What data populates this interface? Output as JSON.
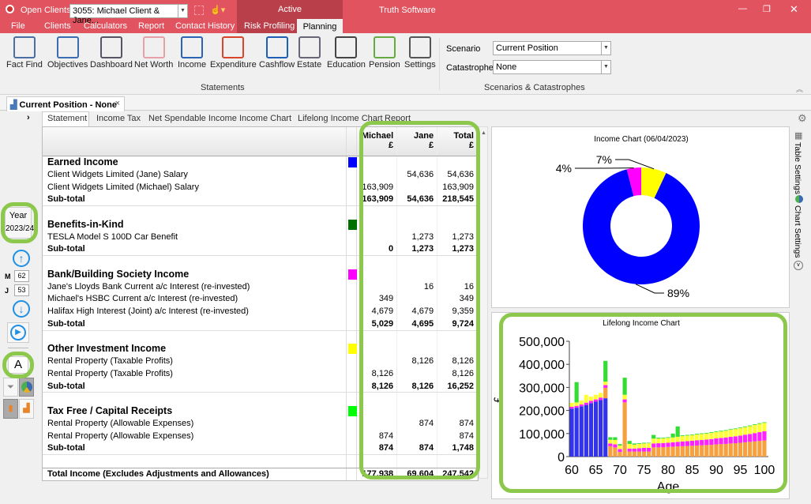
{
  "titlebar": {
    "open_clients_label": "Open Clients:",
    "client": "3055: Michael Client & Jane...",
    "active": "Active",
    "app": "Truth Software"
  },
  "menu": [
    "File",
    "Clients",
    "Calculators",
    "Report",
    "Contact History",
    "Risk Profiling",
    "Planning"
  ],
  "ribbon": {
    "buttons": [
      {
        "label": "Fact Find",
        "icon": "fact-find-icon"
      },
      {
        "label": "Objectives",
        "icon": "mountain-flag-icon"
      },
      {
        "label": "Dashboard",
        "icon": "gauge-icon"
      },
      {
        "label": "Net Worth",
        "icon": "piggy-bank-icon"
      },
      {
        "label": "Income",
        "icon": "rising-chart-icon"
      },
      {
        "label": "Expenditure",
        "icon": "falling-chart-icon"
      },
      {
        "label": "Cashflow",
        "icon": "cashflow-icon"
      },
      {
        "label": "Estate",
        "icon": "document-quill-icon"
      },
      {
        "label": "Education",
        "icon": "graduation-cap-icon"
      },
      {
        "label": "Pension",
        "icon": "coins-plant-icon"
      },
      {
        "label": "Settings",
        "icon": "sliders-icon"
      }
    ],
    "group_label": "Statements",
    "scenario_label": "Scenario",
    "scenario_value": "Current Position",
    "catastrophe_label": "Catastrophe",
    "catastrophe_value": "None",
    "group2_label": "Scenarios & Catastrophes"
  },
  "doc_tab": "Current Position - None",
  "sub_tabs": [
    "Statement",
    "Income Tax",
    "Net Spendable Income",
    "Income Chart",
    "Lifelong Income Chart",
    "Report"
  ],
  "left": {
    "year_label": "Year",
    "year_value": "2023/24",
    "m_label": "M",
    "m_value": "62",
    "j_label": "J",
    "j_value": "53",
    "a_label": "A"
  },
  "table": {
    "headers": [
      {
        "name": "Michael",
        "unit": "£"
      },
      {
        "name": "Jane",
        "unit": "£"
      },
      {
        "name": "Total",
        "unit": "£"
      }
    ],
    "rows": [
      {
        "t": "sec",
        "label": "Earned Income",
        "color": "#0000ff"
      },
      {
        "label": "Client Widgets Limited (Jane) Salary",
        "v": [
          "",
          "54,636",
          "54,636"
        ]
      },
      {
        "label": "Client Widgets Limited (Michael) Salary",
        "v": [
          "163,909",
          "",
          "163,909"
        ]
      },
      {
        "t": "sub",
        "label": "Sub-total",
        "v": [
          "163,909",
          "54,636",
          "218,545"
        ]
      },
      {
        "t": "blank"
      },
      {
        "t": "sec",
        "label": "Benefits-in-Kind",
        "color": "#007000"
      },
      {
        "label": "TESLA Model S 100D Car Benefit",
        "v": [
          "",
          "1,273",
          "1,273"
        ]
      },
      {
        "t": "sub",
        "label": "Sub-total",
        "v": [
          "0",
          "1,273",
          "1,273"
        ]
      },
      {
        "t": "blank"
      },
      {
        "t": "sec",
        "label": "Bank/Building Society Income",
        "color": "#ff00ff"
      },
      {
        "label": "Jane's Lloyds Bank Current a/c Interest (re-invested)",
        "v": [
          "",
          "16",
          "16"
        ]
      },
      {
        "label": "Michael's HSBC Current a/c Interest (re-invested)",
        "v": [
          "349",
          "",
          "349"
        ]
      },
      {
        "label": "Halifax High Interest (Joint) a/c Interest (re-invested)",
        "v": [
          "4,679",
          "4,679",
          "9,359"
        ]
      },
      {
        "t": "sub",
        "label": "Sub-total",
        "v": [
          "5,029",
          "4,695",
          "9,724"
        ]
      },
      {
        "t": "blank"
      },
      {
        "t": "sec",
        "label": "Other Investment Income",
        "color": "#ffff00"
      },
      {
        "label": "Rental Property (Taxable Profits)",
        "v": [
          "",
          "8,126",
          "8,126"
        ]
      },
      {
        "label": "Rental Property (Taxable Profits)",
        "v": [
          "8,126",
          "",
          "8,126"
        ]
      },
      {
        "t": "sub",
        "label": "Sub-total",
        "v": [
          "8,126",
          "8,126",
          "16,252"
        ]
      },
      {
        "t": "blank"
      },
      {
        "t": "sec",
        "label": "Tax Free / Capital Receipts",
        "color": "#00ff00"
      },
      {
        "label": "Rental Property (Allowable Expenses)",
        "v": [
          "",
          "874",
          "874"
        ]
      },
      {
        "label": "Rental Property (Allowable Expenses)",
        "v": [
          "874",
          "",
          "874"
        ]
      },
      {
        "t": "sub",
        "label": "Sub-total",
        "v": [
          "874",
          "874",
          "1,748"
        ]
      },
      {
        "t": "blank"
      },
      {
        "t": "tot",
        "label": "Total Income (Excludes Adjustments and Allowances)",
        "v": [
          "177,938",
          "69,604",
          "247,542"
        ]
      }
    ]
  },
  "side_tabs": {
    "table_settings": "Table Settings",
    "chart_settings": "Chart Settings"
  },
  "chart_data": [
    {
      "type": "pie",
      "title": "Income Chart (06/04/2023)",
      "donut": true,
      "slices": [
        {
          "label": "89%",
          "value": 89,
          "color": "#0000ff"
        },
        {
          "label": "4%",
          "value": 4,
          "color": "#ff00ff"
        },
        {
          "label": "7%",
          "value": 7,
          "color": "#ffff00"
        }
      ]
    },
    {
      "type": "bar",
      "stacked": true,
      "title": "Lifelong Income Chart",
      "xlabel": "Age",
      "ylabel": "£",
      "ylim": [
        0,
        500000
      ],
      "yticks": [
        "0",
        "100,000",
        "200,000",
        "300,000",
        "400,000",
        "500,000"
      ],
      "xticks": [
        "60",
        "65",
        "70",
        "75",
        "80",
        "85",
        "90",
        "95",
        "100"
      ],
      "x": [
        60,
        61,
        62,
        63,
        64,
        65,
        66,
        67,
        68,
        69,
        70,
        71,
        72,
        73,
        74,
        75,
        76,
        77,
        78,
        79,
        80,
        81,
        82,
        83,
        84,
        85,
        86,
        87,
        88,
        89,
        90,
        91,
        92,
        93,
        94,
        95,
        96,
        97,
        98,
        99,
        100
      ],
      "series": [
        {
          "color": "#3333ee",
          "values": [
            208000,
            212000,
            218000,
            224000,
            232000,
            238000,
            245000,
            253000,
            0,
            0,
            0,
            0,
            0,
            0,
            0,
            0,
            0,
            0,
            0,
            0,
            0,
            0,
            0,
            0,
            0,
            0,
            0,
            0,
            0,
            0,
            0,
            0,
            0,
            0,
            0,
            0,
            0,
            0,
            0,
            0,
            0
          ]
        },
        {
          "color": "#f7a040",
          "values": [
            0,
            0,
            0,
            0,
            0,
            0,
            0,
            45000,
            45000,
            40000,
            20000,
            235000,
            22000,
            22000,
            22000,
            22000,
            22000,
            40000,
            40000,
            41000,
            42000,
            43000,
            44000,
            45000,
            46000,
            47000,
            48000,
            49000,
            50000,
            51000,
            53000,
            54000,
            55000,
            57000,
            58000,
            60000,
            62000,
            64000,
            66000,
            68000,
            70000
          ]
        },
        {
          "color": "#ff22ff",
          "values": [
            8000,
            8000,
            8000,
            10000,
            10000,
            10000,
            11000,
            12000,
            12000,
            13000,
            13000,
            13000,
            13000,
            13000,
            14000,
            16000,
            16000,
            17000,
            18000,
            18000,
            18000,
            19000,
            20000,
            21000,
            21000,
            22000,
            23000,
            23000,
            24000,
            25000,
            26000,
            27000,
            28000,
            29000,
            30000,
            31000,
            33000,
            34000,
            36000,
            38000,
            40000
          ]
        },
        {
          "color": "#ffff33",
          "values": [
            17000,
            15000,
            17000,
            34000,
            18000,
            20000,
            20000,
            15000,
            16000,
            19000,
            15000,
            20000,
            20000,
            17000,
            19000,
            19000,
            20000,
            21000,
            20000,
            20000,
            21000,
            21000,
            22000,
            23000,
            24000,
            24000,
            25000,
            26000,
            26000,
            27000,
            28000,
            28000,
            29000,
            30000,
            31000,
            32000,
            33000,
            34000,
            35000,
            36000,
            36000
          ]
        },
        {
          "color": "#33dd33",
          "values": [
            0,
            88000,
            0,
            0,
            0,
            0,
            0,
            90000,
            11000,
            12000,
            6000,
            74000,
            13000,
            5000,
            3000,
            3000,
            2000,
            16000,
            4000,
            3000,
            3000,
            17000,
            45000,
            3000,
            3000,
            3000,
            3000,
            3000,
            3000,
            3000,
            3000,
            3000,
            3000,
            3000,
            3000,
            3000,
            3000,
            3000,
            3000,
            3000,
            3000
          ]
        }
      ]
    }
  ]
}
